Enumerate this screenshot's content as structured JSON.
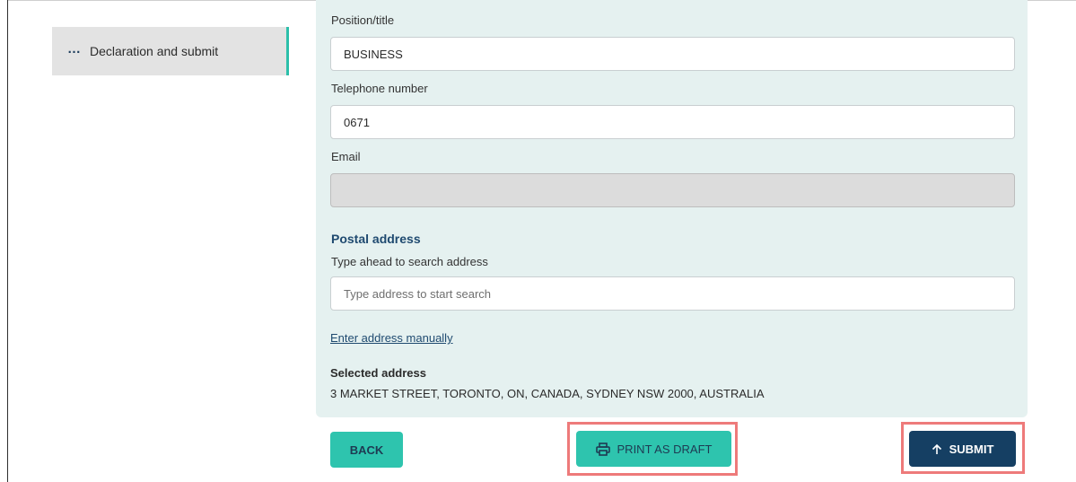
{
  "sidebar": {
    "items": [
      {
        "label": "Declaration and submit",
        "icon": "ellipsis-icon"
      }
    ]
  },
  "form": {
    "position": {
      "label": "Position/title",
      "value": "BUSINESS"
    },
    "telephone": {
      "label": "Telephone number",
      "value": "0671"
    },
    "email": {
      "label": "Email",
      "value": ""
    },
    "postal": {
      "heading": "Postal address",
      "search_label": "Type ahead to search address",
      "search_placeholder": "Type address to start search",
      "manual_link": "Enter address manually",
      "selected_title": "Selected address",
      "selected_value": "3 MARKET STREET, TORONTO, ON, CANADA, SYDNEY NSW 2000, AUSTRALIA"
    }
  },
  "actions": {
    "back_label": "BACK",
    "print_label": "PRINT AS DRAFT",
    "submit_label": "SUBMIT"
  },
  "colors": {
    "accent": "#2ec4ae",
    "primary": "#153f63",
    "highlight": "#ee7a7a",
    "panel": "#e5f1f0"
  }
}
